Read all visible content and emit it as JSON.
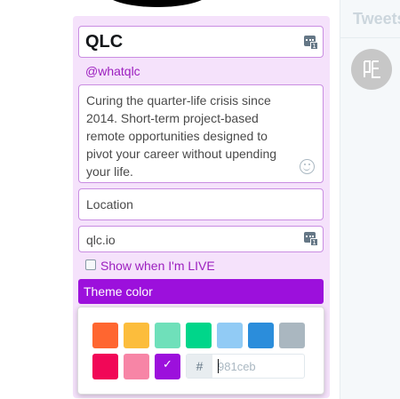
{
  "profile": {
    "name": "QLC",
    "handle": "@whatqlc",
    "bio": "Curing the quarter-life crisis since 2014. Short-term project-based remote opportunities designed to pivot your career without upending your life.",
    "location_placeholder": "Location",
    "website": "qlc.io",
    "live_label": "Show when I'm LIVE",
    "live_checked": false
  },
  "theme": {
    "label": "Theme color",
    "selected_color": "#9c10dc",
    "hex_prefix": "#",
    "hex_placeholder": "981ceb",
    "swatches": [
      {
        "color": "#ff6630",
        "selected": false
      },
      {
        "color": "#fcbd3c",
        "selected": false
      },
      {
        "color": "#6fe0ba",
        "selected": false
      },
      {
        "color": "#00d68a",
        "selected": false
      },
      {
        "color": "#91cbf5",
        "selected": false
      },
      {
        "color": "#2b8ddb",
        "selected": false
      },
      {
        "color": "#aab7c0",
        "selected": false
      },
      {
        "color": "#f10757",
        "selected": false
      },
      {
        "color": "#f785a6",
        "selected": false
      },
      {
        "color": "#9c10dc",
        "selected": true
      }
    ],
    "check_glyph": "✓"
  },
  "icons": {
    "counter": "character-counter-icon",
    "emoji": "emoji-icon",
    "sidebar_avatar": "qlc-logo-avatar"
  },
  "sidebar": {
    "title": "Tweets"
  },
  "colors": {
    "panel_bg": "#f5e2fb",
    "accent": "#9c1fbf",
    "field_border": "#c98de2"
  }
}
